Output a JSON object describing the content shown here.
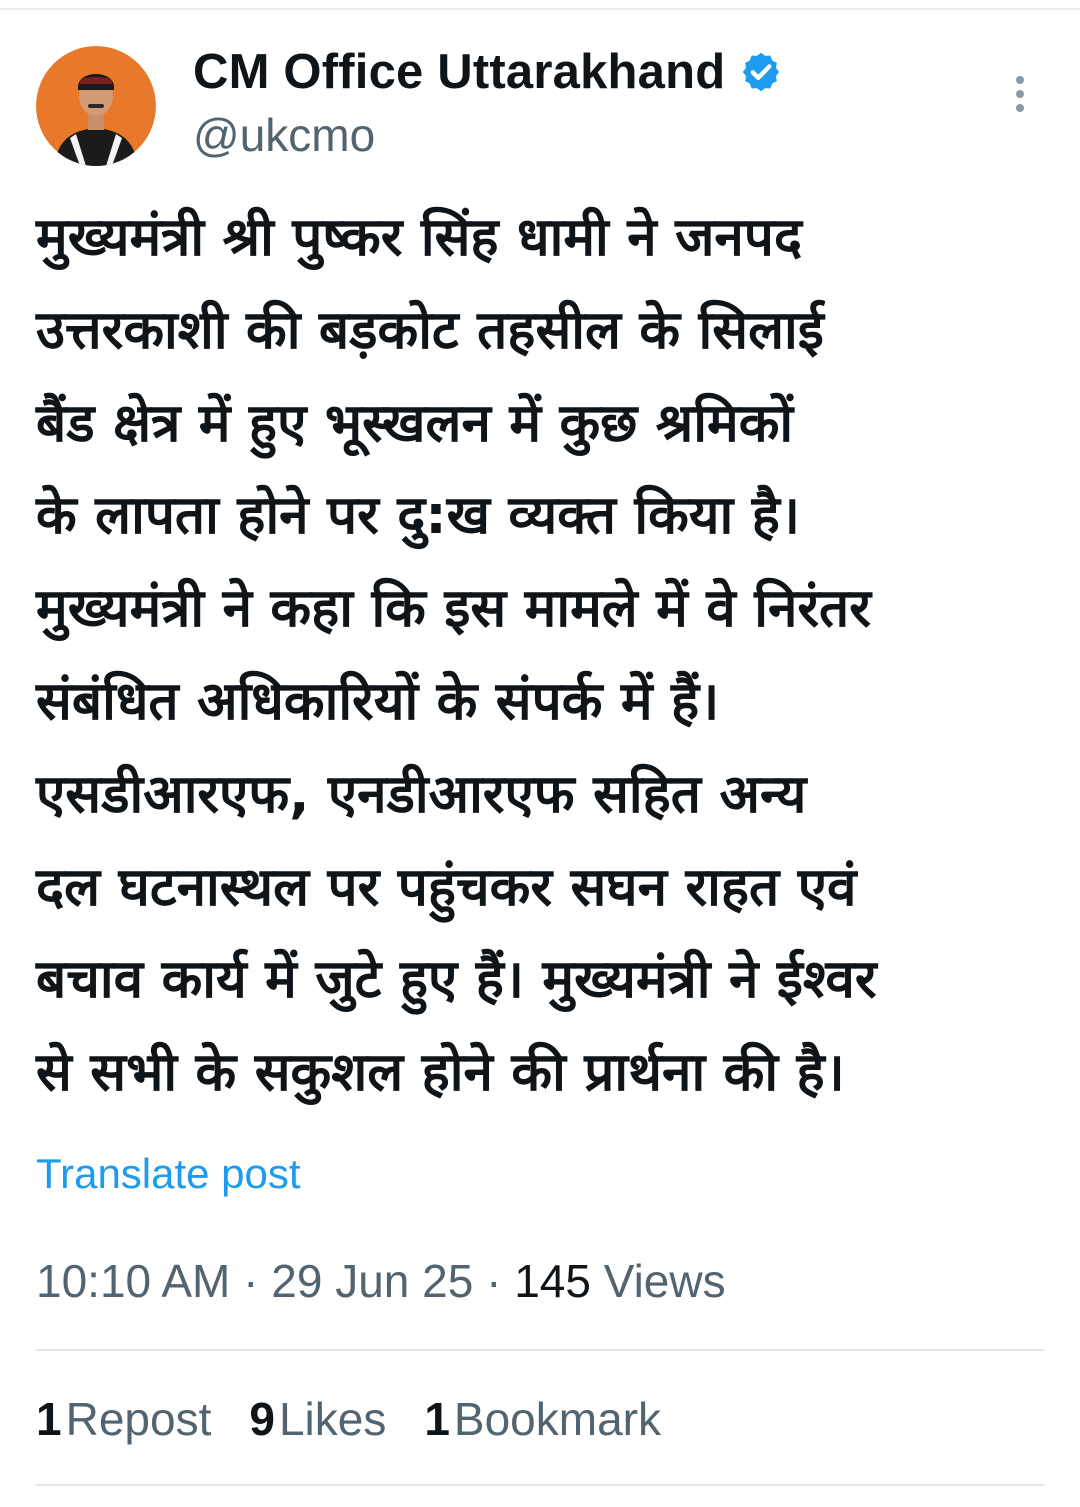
{
  "author": {
    "display_name": "CM Office Uttarakhand",
    "handle": "@ukcmo",
    "verified": true,
    "avatar_icon": "profile-photo"
  },
  "post": {
    "lines": [
      "मुख्यमंत्री श्री पुष्कर सिंह धामी ने जनपद",
      "उत्तरकाशी की बड़कोट तहसील के सिलाई",
      "बैंड क्षेत्र में हुए भूस्खलन में कुछ श्रमिकों",
      "के लापता होने पर दु:ख व्यक्त किया है।",
      "मुख्यमंत्री ने कहा कि इस मामले में वे निरंतर",
      "संबंधित अधिकारियों के संपर्क में हैं।",
      "एसडीआरएफ, एनडीआरएफ सहित अन्य",
      "दल घटनास्थल पर पहुंचकर सघन राहत एवं",
      "बचाव कार्य में जुटे हुए हैं। मुख्यमंत्री ने ईश्वर",
      "से सभी के सकुशल होने की प्रार्थना की है।"
    ],
    "translate_label": "Translate post"
  },
  "meta": {
    "time": "10:10 AM",
    "separator": "·",
    "date": "29 Jun 25",
    "views_count": "145",
    "views_label": "Views"
  },
  "stats": {
    "reposts_count": "1",
    "reposts_label": "Repost",
    "likes_count": "9",
    "likes_label": "Likes",
    "bookmarks_count": "1",
    "bookmarks_label": "Bookmark"
  },
  "colors": {
    "accent": "#1d9bf0",
    "secondary_text": "#536471",
    "primary_text": "#0f1419",
    "avatar_background": "#e8782a"
  },
  "icons": {
    "verified": "verified-badge-icon",
    "more": "more-options-icon"
  }
}
